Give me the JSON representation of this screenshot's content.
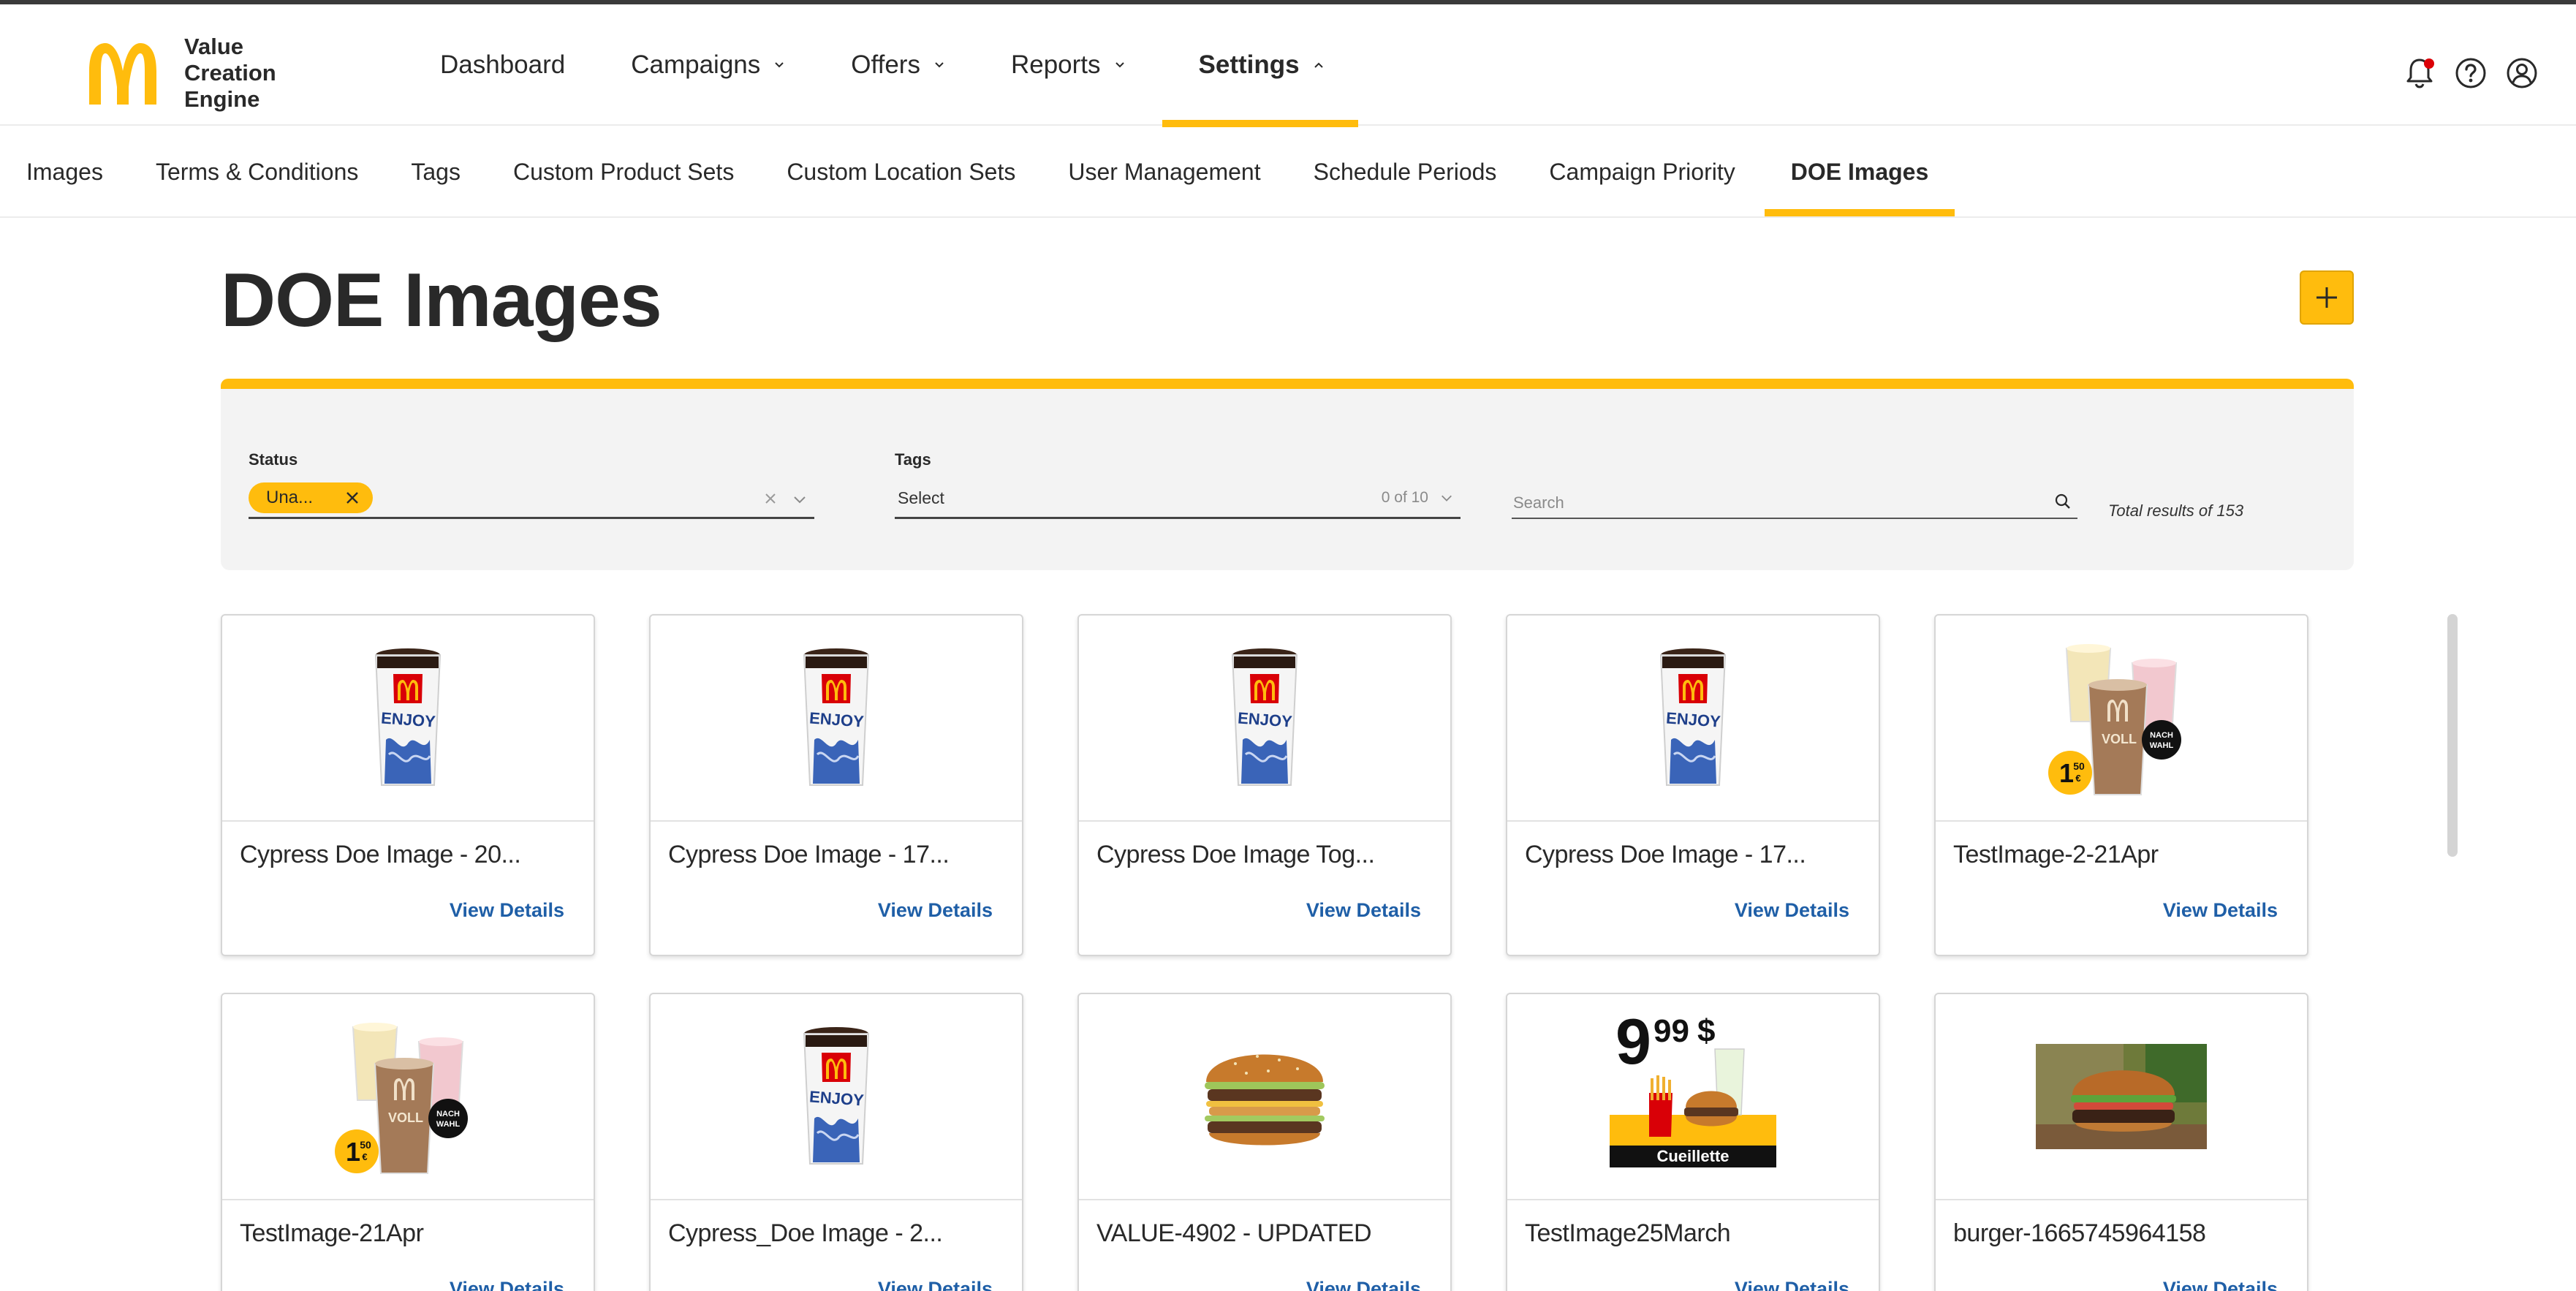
{
  "app": {
    "logo_line1": "Value",
    "logo_line2": "Creation",
    "logo_line3": "Engine"
  },
  "nav": {
    "items": [
      {
        "label": "Dashboard",
        "has_chevron": false,
        "active": false
      },
      {
        "label": "Campaigns",
        "has_chevron": true,
        "active": false
      },
      {
        "label": "Offers",
        "has_chevron": true,
        "active": false
      },
      {
        "label": "Reports",
        "has_chevron": true,
        "active": false
      },
      {
        "label": "Settings",
        "has_chevron": true,
        "active": true
      }
    ]
  },
  "header_icons": [
    "bell-icon",
    "help-icon",
    "user-icon"
  ],
  "subnav": {
    "items": [
      {
        "label": "Images"
      },
      {
        "label": "Terms & Conditions"
      },
      {
        "label": "Tags"
      },
      {
        "label": "Custom Product Sets"
      },
      {
        "label": "Custom Location Sets"
      },
      {
        "label": "User Management"
      },
      {
        "label": "Schedule Periods"
      },
      {
        "label": "Campaign Priority"
      },
      {
        "label": "DOE Images",
        "active": true
      }
    ]
  },
  "page": {
    "title": "DOE Images"
  },
  "filters": {
    "status_label": "Status",
    "status_chip": "Una...",
    "tags_label": "Tags",
    "tags_value": "Select",
    "tags_count": "0 of 10",
    "search_placeholder": "Search",
    "total_results": "Total results of 153"
  },
  "colors": {
    "accent": "#ffbc0d",
    "link": "#1f5fa7",
    "notification": "#db0007"
  },
  "cards": [
    {
      "title": "Cypress Doe Image - 20...",
      "link": "View Details",
      "image": "drink-cup"
    },
    {
      "title": "Cypress Doe Image - 17...",
      "link": "View Details",
      "image": "drink-cup"
    },
    {
      "title": "Cypress Doe Image Tog...",
      "link": "View Details",
      "image": "drink-cup"
    },
    {
      "title": "Cypress Doe Image - 17...",
      "link": "View Details",
      "image": "drink-cup"
    },
    {
      "title": "TestImage-2-21Apr",
      "link": "View Details",
      "image": "shakes"
    },
    {
      "title": "TestImage-21Apr",
      "link": "View Details",
      "image": "shakes"
    },
    {
      "title": "Cypress_Doe Image - 2...",
      "link": "View Details",
      "image": "drink-cup"
    },
    {
      "title": "VALUE-4902 - UPDATED",
      "link": "View Details",
      "image": "big-mac"
    },
    {
      "title": "TestImage25March",
      "link": "View Details",
      "image": "meal-deal"
    },
    {
      "title": "burger-1665745964158",
      "link": "View Details",
      "image": "burger-photo"
    }
  ],
  "image_text": {
    "cup_enjoy": "ENJOY",
    "shake_price_main": "1",
    "shake_price_cents": "50",
    "shake_price_unit": "€",
    "shake_badge_line1": "NACH",
    "shake_badge_line2": "WAHL",
    "shake_cup_text": "VOLL",
    "meal_price_main": "9",
    "meal_price_cents": "99",
    "meal_price_unit": "$",
    "meal_banner": "Cueillette"
  }
}
